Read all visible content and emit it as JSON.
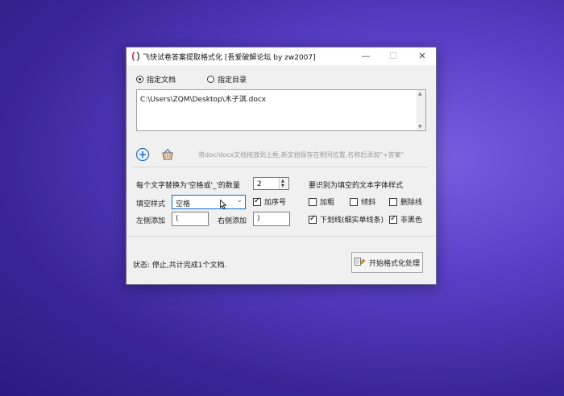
{
  "window": {
    "title": "飞快试卷答案提取格式化 [吾爱破解论坛 by zw2007]",
    "minimize_glyph": "—",
    "maximize_glyph": "☐",
    "close_glyph": "✕"
  },
  "source": {
    "option_file": "指定文档",
    "option_dir": "指定目录",
    "selected": "file",
    "path": "C:\\Users\\ZQM\\Desktop\\木子淇.docx"
  },
  "toolbar": {
    "add_icon": "plus-circle-icon",
    "clear_icon": "basket-icon",
    "hint": "将doc/docx文档拖放到上框,新文档保存在相同位置,名称后添加\"+答案\""
  },
  "options": {
    "replace_count_label": "每个文字替换为'空格或'_'的数量",
    "replace_count_value": "2",
    "fill_style_label": "填空样式",
    "fill_style_value": "空格",
    "add_number_label": "加序号",
    "add_number_checked": true,
    "left_label": "左侧添加",
    "left_value": "(",
    "right_label": "右侧添加",
    "right_value": ")"
  },
  "font_style": {
    "heading": "要识别为填空的文本字体样式",
    "bold": {
      "label": "加粗",
      "checked": false
    },
    "italic": {
      "label": "倾斜",
      "checked": false
    },
    "strike": {
      "label": "删除线",
      "checked": false
    },
    "underline": {
      "label": "下划线(细实单线条)",
      "checked": true
    },
    "non_black": {
      "label": "非黑色",
      "checked": true
    }
  },
  "status": {
    "text": "状态: 停止,共计完成1个文档."
  },
  "actions": {
    "start_label": "开始格式化处理",
    "start_icon": "format-icon"
  },
  "colors": {
    "accent": "#0a6cc7",
    "title_icon_red": "#c0392b"
  }
}
